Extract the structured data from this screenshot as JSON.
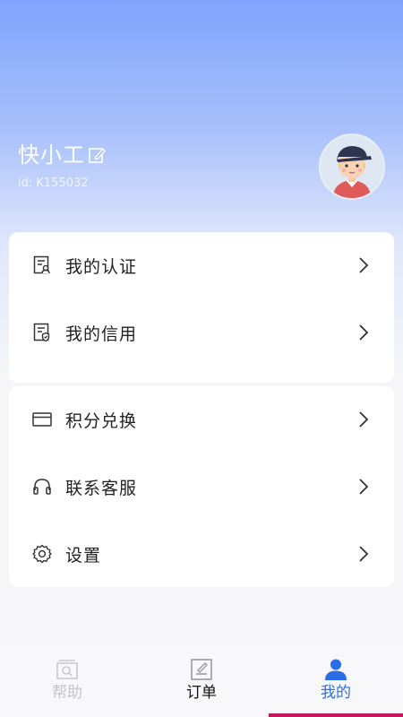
{
  "profile": {
    "username": "快小工",
    "user_id": "id:  K155032"
  },
  "menu": {
    "group1": [
      {
        "label": "我的认证",
        "icon": "certification-icon"
      },
      {
        "label": "我的信用",
        "icon": "credit-icon"
      }
    ],
    "group2": [
      {
        "label": "积分兑换",
        "icon": "wallet-card-icon"
      },
      {
        "label": "联系客服",
        "icon": "headset-icon"
      },
      {
        "label": "设置",
        "icon": "gear-icon"
      }
    ]
  },
  "tabbar": {
    "tabs": [
      {
        "label": "帮助",
        "icon": "help-search-icon",
        "active": false
      },
      {
        "label": "订单",
        "icon": "order-icon",
        "active": false
      },
      {
        "label": "我的",
        "icon": "person-icon",
        "active": true
      }
    ]
  },
  "colors": {
    "header_gradient_top": "#7ea4fb",
    "active_tab": "#2b6de6",
    "inactive_tab": "#c3c3c8",
    "indicator": "#c2185b"
  }
}
